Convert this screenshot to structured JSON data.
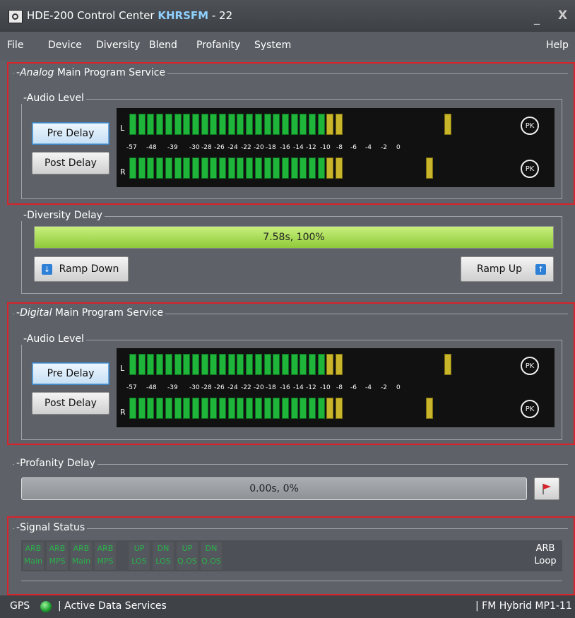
{
  "window": {
    "title_prefix": "HDE-200 Control Center",
    "station": "KHRSFM",
    "title_suffix": "- 22",
    "minimize": "_",
    "close": "X"
  },
  "menu": [
    "File",
    "Device",
    "Diversity",
    "Blend",
    "Profanity",
    "System",
    "Help"
  ],
  "analog": {
    "legend_italic": "Analog",
    "legend_rest": "Main Program Service",
    "audio_level_legend": "Audio Level",
    "pre_delay": "Pre Delay",
    "post_delay": "Post Delay",
    "left_label": "L",
    "right_label": "R",
    "pk": "PK"
  },
  "meter_scale": [
    "-57",
    "-48",
    "-39",
    "-30",
    "-28",
    "-26",
    "-24",
    "-22",
    "-20",
    "-18",
    "-16",
    "-14",
    "-12",
    "-10",
    "-8",
    "-6",
    "-4",
    "-2",
    "0"
  ],
  "diversity": {
    "legend": "Diversity Delay",
    "value": "7.58s, 100%",
    "progress": 1.0,
    "ramp_down": "Ramp Down",
    "ramp_up": "Ramp Up"
  },
  "digital": {
    "legend_italic": "Digital",
    "legend_rest": "Main Program Service",
    "audio_level_legend": "Audio Level",
    "pre_delay": "Pre Delay",
    "post_delay": "Post Delay",
    "left_label": "L",
    "right_label": "R",
    "pk": "PK"
  },
  "profanity": {
    "legend": "Profanity Delay",
    "value": "0.00s, 0%",
    "progress": 0.0
  },
  "signal_status": {
    "legend": "Signal Status",
    "indicators": [
      {
        "top": "ARB",
        "bottom": "Main"
      },
      {
        "top": "ARB",
        "bottom": "MPS"
      },
      {
        "top": "ARB",
        "bottom": "Main"
      },
      {
        "top": "ARB",
        "bottom": "MPS"
      },
      {
        "top": "UP",
        "bottom": "LOS"
      },
      {
        "top": "DN",
        "bottom": "LOS"
      },
      {
        "top": "UP",
        "bottom": "Q.OS"
      },
      {
        "top": "DN",
        "bottom": "Q.OS"
      }
    ],
    "arb_loop_top": "ARB",
    "arb_loop_bottom": "Loop"
  },
  "statusbar": {
    "gps": "GPS",
    "active_data": "| Active Data Services",
    "mode": "| FM Hybrid MP1-11"
  },
  "colors": {
    "accent_red": "#d8232a",
    "meter_green": "#1eb53a",
    "meter_yellow": "#c9b52a",
    "station_blue": "#8fd0ff",
    "status_green": "#2ab24a"
  }
}
